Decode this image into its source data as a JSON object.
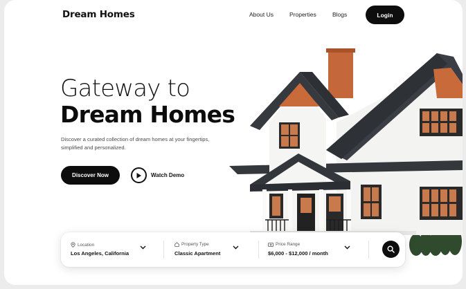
{
  "brand": "Dream Homes",
  "nav": {
    "links": [
      "About Us",
      "Properties",
      "Blogs"
    ],
    "login_label": "Login"
  },
  "hero": {
    "title_line1": "Gateway to",
    "title_line2": "Dream Homes",
    "subtitle": "Discover a curated collection of dream homes at your fingertips, simplified and personalized.",
    "primary_cta": "Discover Now",
    "secondary_cta": "Watch Demo"
  },
  "search": {
    "fields": [
      {
        "label": "Location",
        "value": "Los Angeles, California",
        "icon": "map-pin-icon"
      },
      {
        "label": "Property Type",
        "value": "Classic Apartment",
        "icon": "home-icon"
      },
      {
        "label": "Price Range",
        "value": "$6,000 - $12,000 / month",
        "icon": "money-icon"
      }
    ],
    "button_icon": "search-icon"
  },
  "colors": {
    "accent": "#0d0d0d",
    "background": "#ffffff",
    "roof": "#3a3d42",
    "chimney": "#c0643a",
    "wall": "#f5f5f3"
  }
}
